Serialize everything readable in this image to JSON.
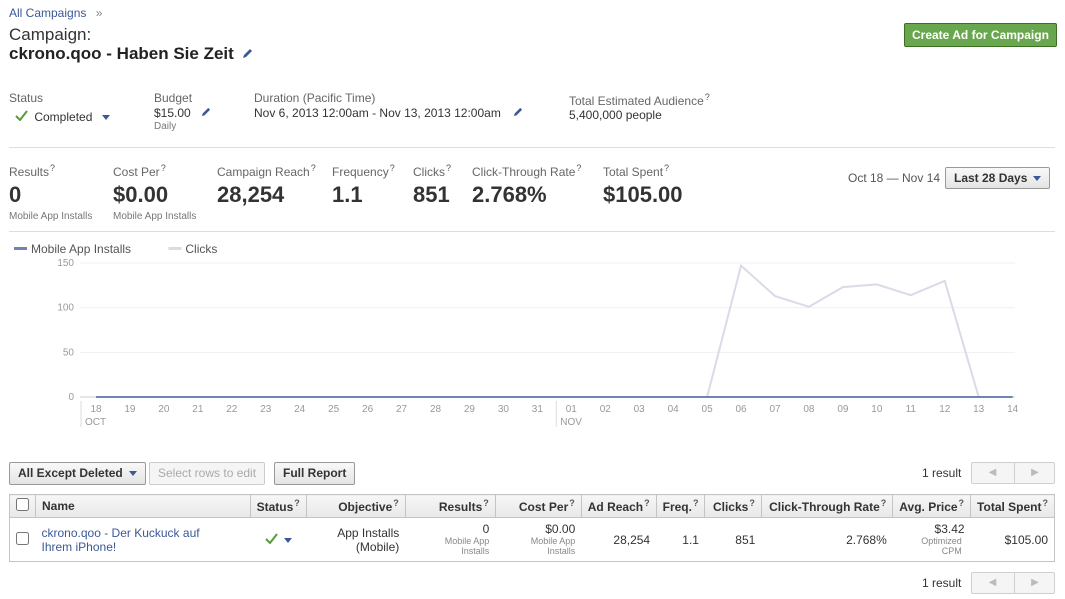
{
  "breadcrumb": {
    "link": "All Campaigns",
    "sep": "»"
  },
  "campaign": {
    "label": "Campaign:",
    "name": "ckrono.qoo - Haben Sie Zeit"
  },
  "create_button": "Create Ad for Campaign",
  "info": {
    "status_label": "Status",
    "status_value": "Completed",
    "budget_label": "Budget",
    "budget_value": "$15.00",
    "budget_sub": "Daily",
    "duration_label": "Duration (Pacific Time)",
    "duration_value": "Nov 6, 2013 12:00am - Nov 13, 2013 12:00am",
    "audience_label": "Total Estimated Audience",
    "audience_value": "5,400,000 people",
    "q": "?"
  },
  "stats": [
    {
      "label": "Results",
      "value": "0",
      "sub": "Mobile App Installs"
    },
    {
      "label": "Cost Per",
      "value": "$0.00",
      "sub": "Mobile App Installs"
    },
    {
      "label": "Campaign Reach",
      "value": "28,254",
      "sub": ""
    },
    {
      "label": "Frequency",
      "value": "1.1",
      "sub": ""
    },
    {
      "label": "Clicks",
      "value": "851",
      "sub": ""
    },
    {
      "label": "Click-Through Rate",
      "value": "2.768%",
      "sub": ""
    },
    {
      "label": "Total Spent",
      "value": "$105.00",
      "sub": ""
    }
  ],
  "date_range": {
    "text": "Oct 18 — Nov 14",
    "button": "Last 28 Days"
  },
  "chart_data": {
    "type": "line",
    "x": [
      "18",
      "19",
      "20",
      "21",
      "22",
      "23",
      "24",
      "25",
      "26",
      "27",
      "28",
      "29",
      "30",
      "31",
      "01",
      "02",
      "03",
      "04",
      "05",
      "06",
      "07",
      "08",
      "09",
      "10",
      "11",
      "12",
      "13",
      "14"
    ],
    "month_labels": [
      {
        "at": "18",
        "text": "OCT"
      },
      {
        "at": "01",
        "text": "NOV"
      }
    ],
    "ylim": [
      0,
      150
    ],
    "y_ticks": [
      "0",
      "50",
      "100",
      "150"
    ],
    "series": [
      {
        "name": "Mobile App Installs",
        "color": "#6d84b4",
        "values": [
          0,
          0,
          0,
          0,
          0,
          0,
          0,
          0,
          0,
          0,
          0,
          0,
          0,
          0,
          0,
          0,
          0,
          0,
          0,
          0,
          0,
          0,
          0,
          0,
          0,
          0,
          0,
          0
        ]
      },
      {
        "name": "Clicks",
        "color": "#d8dbe8",
        "values": [
          null,
          null,
          null,
          null,
          null,
          null,
          null,
          null,
          null,
          null,
          null,
          null,
          null,
          null,
          null,
          null,
          null,
          null,
          0,
          147,
          113,
          101,
          123,
          126,
          114,
          130,
          0,
          null
        ]
      }
    ]
  },
  "toolbar": {
    "filter": "All Except Deleted",
    "edit": "Select rows to edit",
    "report": "Full Report",
    "results": "1 result"
  },
  "table": {
    "headers": {
      "name": "Name",
      "status": "Status",
      "objective": "Objective",
      "results": "Results",
      "cost": "Cost Per",
      "reach": "Ad Reach",
      "freq": "Freq.",
      "clicks": "Clicks",
      "ctr": "Click-Through Rate",
      "price": "Avg. Price",
      "spent": "Total Spent"
    },
    "q": "?",
    "row": {
      "name": "ckrono.qoo - Der Kuckuck auf Ihrem iPhone!",
      "objective": "App Installs (Mobile)",
      "results": "0",
      "results_sub": "Mobile App Installs",
      "cost": "$0.00",
      "cost_sub": "Mobile App Installs",
      "reach": "28,254",
      "freq": "1.1",
      "clicks": "851",
      "ctr": "2.768%",
      "price": "$3.42",
      "price_sub": "Optimized CPM",
      "spent": "$105.00"
    }
  },
  "footer": {
    "results": "1 result"
  },
  "icons": {
    "pencil": "pencil-icon",
    "check": "checkmark-icon",
    "prev": "◀",
    "next": "▶"
  }
}
